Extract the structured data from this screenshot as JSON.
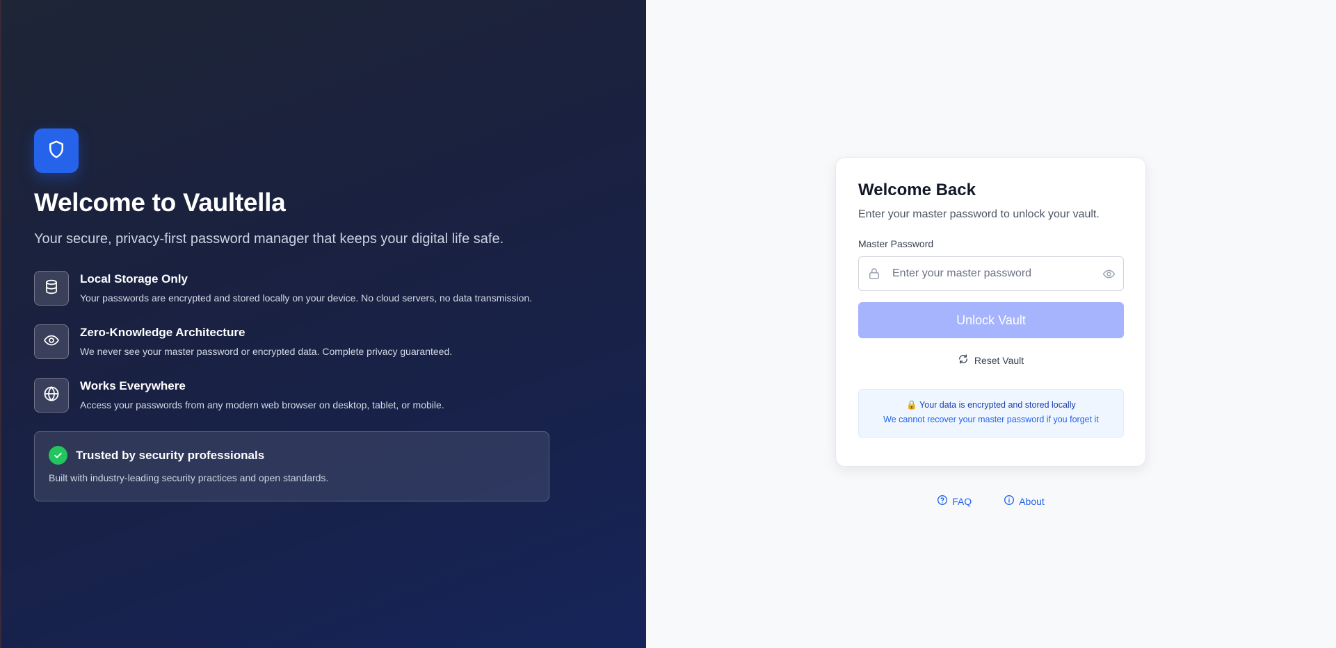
{
  "hero": {
    "logo_icon": "shield-icon",
    "title": "Welcome to Vaultella",
    "subtitle": "Your secure, privacy-first password manager that keeps your digital life safe.",
    "features": [
      {
        "icon": "database-icon",
        "title": "Local Storage Only",
        "description": "Your passwords are encrypted and stored locally on your device. No cloud servers, no data transmission."
      },
      {
        "icon": "eye-icon",
        "title": "Zero-Knowledge Architecture",
        "description": "We never see your master password or encrypted data. Complete privacy guaranteed."
      },
      {
        "icon": "globe-icon",
        "title": "Works Everywhere",
        "description": "Access your passwords from any modern web browser on desktop, tablet, or mobile."
      }
    ],
    "trust": {
      "icon": "check-icon",
      "title": "Trusted by security professionals",
      "description": "Built with industry-leading security practices and open standards."
    }
  },
  "login": {
    "title": "Welcome Back",
    "subtitle": "Enter your master password to unlock your vault.",
    "password_label": "Master Password",
    "password_placeholder": "Enter your master password",
    "password_value": "",
    "unlock_label": "Unlock Vault",
    "reset_label": "Reset Vault",
    "notice_line1": "🔒 Your data is encrypted and stored locally",
    "notice_line2": "We cannot recover your master password if you forget it"
  },
  "footer": {
    "faq_label": "FAQ",
    "about_label": "About"
  },
  "colors": {
    "accent": "#2563eb",
    "button_disabled": "#a5b4fc",
    "success": "#22c55e",
    "hero_bg": "#1a2140"
  }
}
